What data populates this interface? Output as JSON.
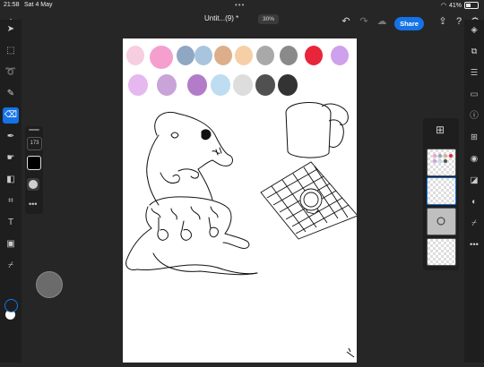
{
  "status": {
    "time": "21:58",
    "date": "Sat 4 May",
    "battery_text": "41%",
    "battery_level": 0.41
  },
  "header": {
    "doc_title": "Untit...(9) *",
    "zoom": "30%",
    "share_label": "Share"
  },
  "brush": {
    "size": "173"
  },
  "palette_colors": [
    "#f7cde0",
    "#f59fcf",
    "#8fa7c2",
    "#a9c4dd",
    "#dcaf8a",
    "#f6cfa7",
    "#a9a9a9",
    "#8a8a8a",
    "#e8253b",
    "#cfa0ec",
    "#e5b8ef",
    "#c9a4d8",
    "#b37cc9",
    "#bedcf2",
    "#dddddd",
    "#505050",
    "#333333"
  ],
  "colors": {
    "accent": "#1473e6",
    "toolbar_bg": "#1e1e1e",
    "workspace_bg": "#262626"
  }
}
